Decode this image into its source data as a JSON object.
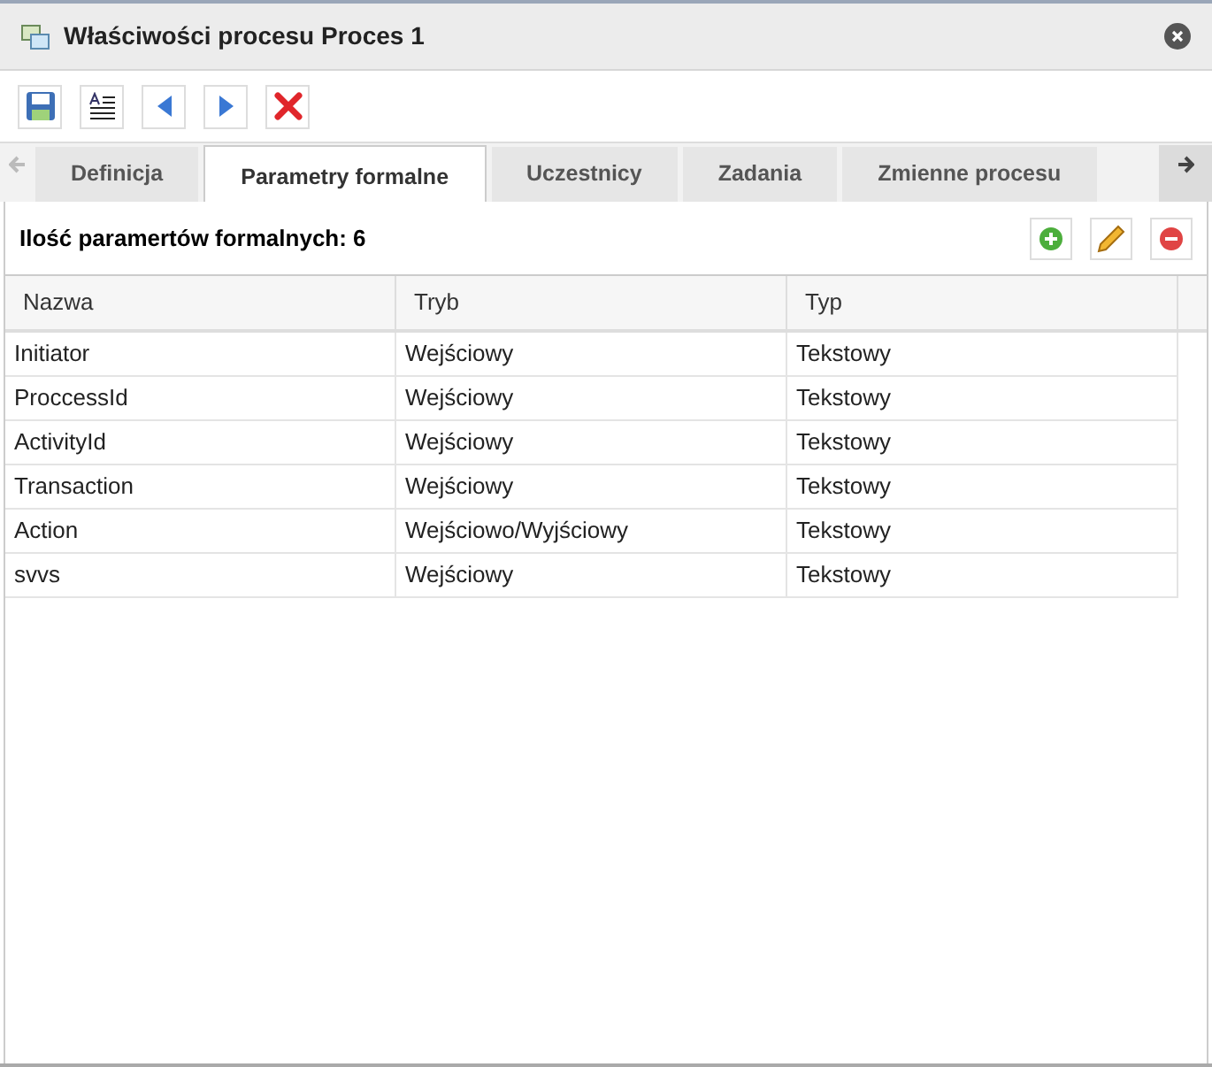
{
  "window": {
    "title": "Właściwości procesu Proces 1"
  },
  "tabs": [
    {
      "label": "Definicja",
      "selected": false
    },
    {
      "label": "Parametry formalne",
      "selected": true
    },
    {
      "label": "Uczestnicy",
      "selected": false
    },
    {
      "label": "Zadania",
      "selected": false
    },
    {
      "label": "Zmienne procesu",
      "selected": false
    }
  ],
  "section": {
    "title": "Ilość paramertów formalnych: 6"
  },
  "table": {
    "columns": [
      "Nazwa",
      "Tryb",
      "Typ"
    ],
    "rows": [
      [
        "Initiator",
        "Wejściowy",
        "Tekstowy"
      ],
      [
        "ProccessId",
        "Wejściowy",
        "Tekstowy"
      ],
      [
        "ActivityId",
        "Wejściowy",
        "Tekstowy"
      ],
      [
        "Transaction",
        "Wejściowy",
        "Tekstowy"
      ],
      [
        "Action",
        "Wejściowo/Wyjściowy",
        "Tekstowy"
      ],
      [
        "svvs",
        "Wejściowy",
        "Tekstowy"
      ]
    ]
  }
}
